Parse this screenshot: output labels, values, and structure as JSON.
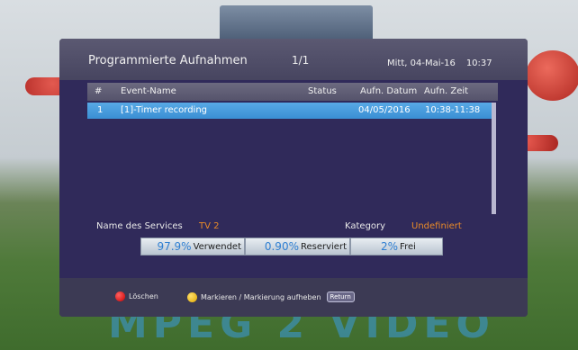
{
  "header": {
    "title": "Programmierte Aufnahmen",
    "page": "1/1",
    "date": "Mitt, 04-Mai-16",
    "time": "10:37"
  },
  "table": {
    "columns": [
      "#",
      "Event-Name",
      "Status",
      "Aufn. Datum",
      "Aufn. Zeit"
    ],
    "rows": [
      {
        "num": "1",
        "event": "[1]-Timer recording",
        "status": "",
        "date": "04/05/2016",
        "time": "10:38-11:38"
      }
    ]
  },
  "info": {
    "service_label": "Name des Services",
    "service_value": "TV 2",
    "category_label": "Kategory",
    "category_value": "Undefiniert"
  },
  "usage": {
    "used_pct": "97.9%",
    "used_label": "Verwendet",
    "reserved_pct": "0.90%",
    "reserved_label": "Reserviert",
    "free_pct": "2%",
    "free_label": "Frei"
  },
  "footer": {
    "red_label": "Löschen",
    "yellow_label": "Markieren / Markierung aufheben",
    "return_label": "Return"
  },
  "background": {
    "caption": "MPEG 2 VIDEO"
  },
  "colors": {
    "highlight": "#3a8fd4",
    "accent_orange": "#e98a28",
    "panel": "#302a5a"
  }
}
